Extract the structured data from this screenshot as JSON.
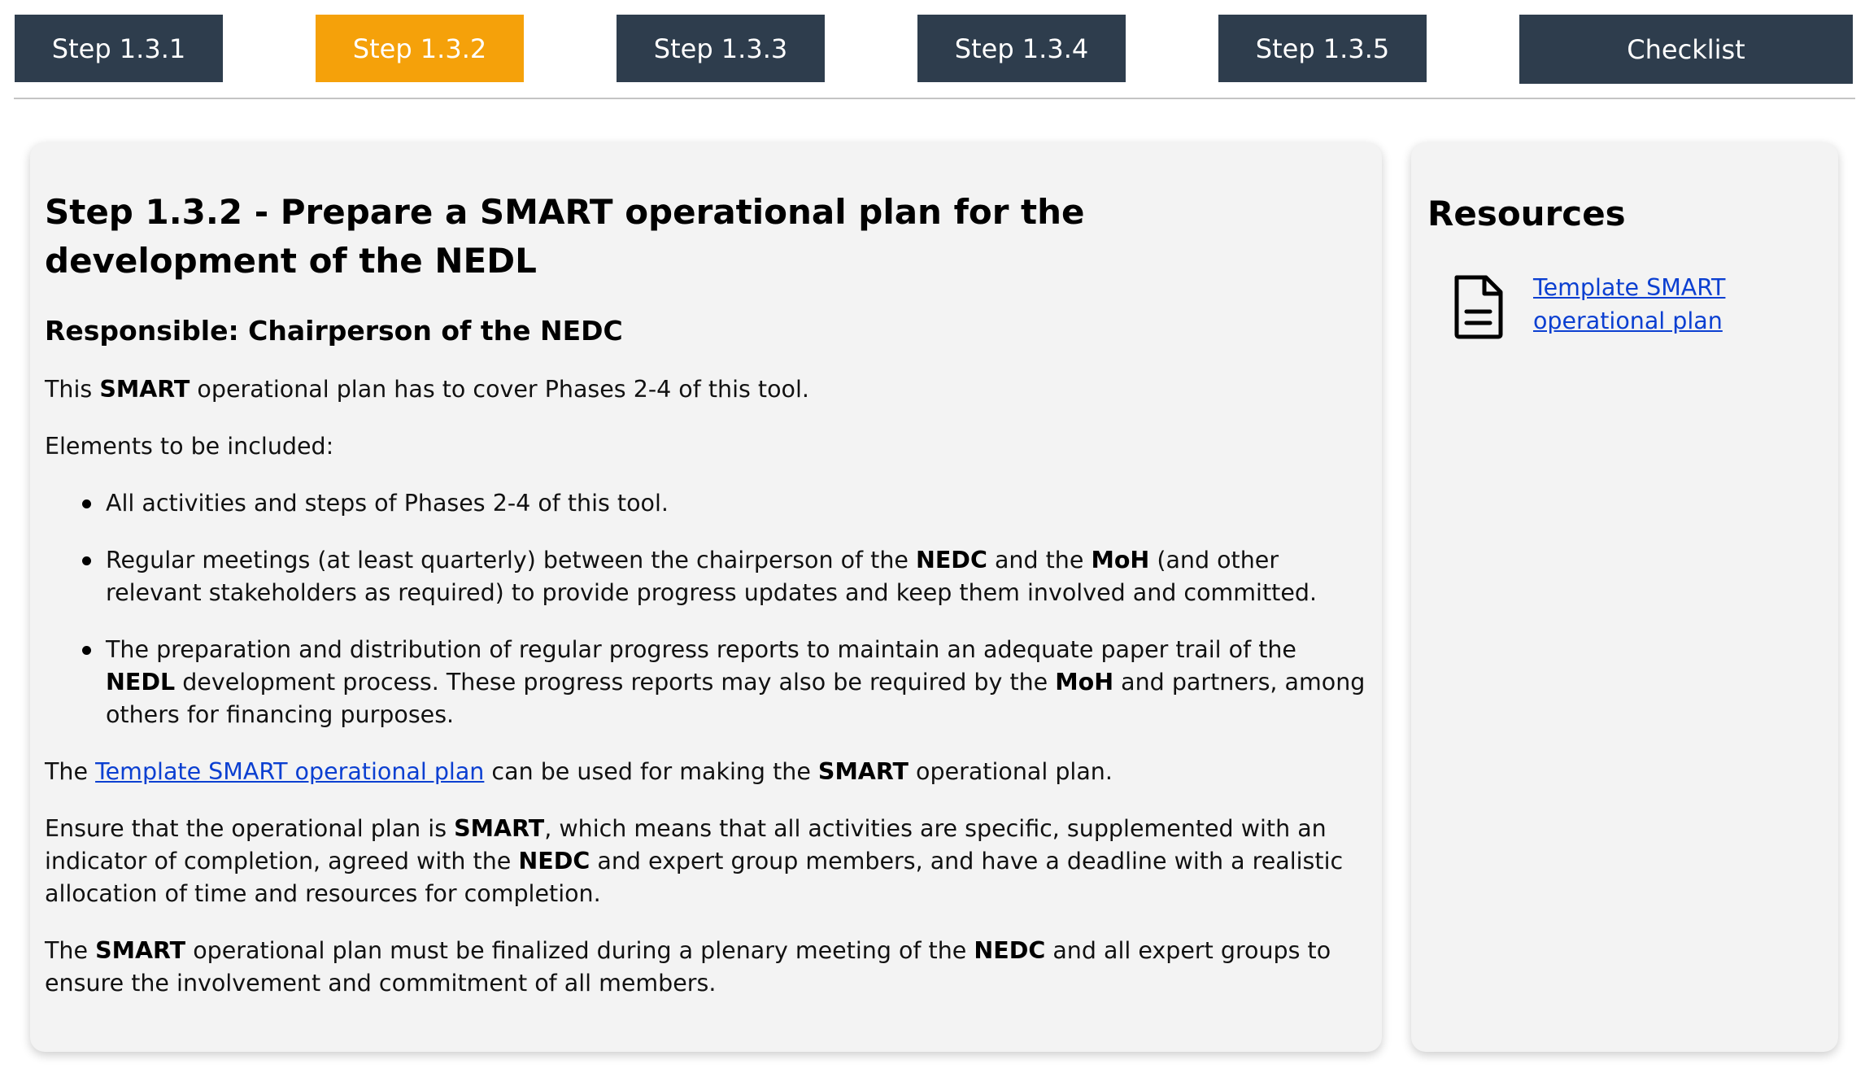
{
  "nav": {
    "steps": [
      {
        "label": "Step 1.3.1",
        "active": false
      },
      {
        "label": "Step 1.3.2",
        "active": true
      },
      {
        "label": "Step 1.3.3",
        "active": false
      },
      {
        "label": "Step 1.3.4",
        "active": false
      },
      {
        "label": "Step 1.3.5",
        "active": false
      }
    ],
    "checklist_label": "Checklist",
    "colors": {
      "default": "#2e3d4d",
      "active": "#f5a10a"
    }
  },
  "main": {
    "title": "Step 1.3.2 - Prepare a SMART operational plan for the development of the NEDL",
    "responsible": "Responsible: Chairperson of the NEDC",
    "intro": {
      "before": "This ",
      "bold": "SMART",
      "after": " operational plan has to cover Phases 2-4 of this tool."
    },
    "elements_heading": "Elements to be included:",
    "bullets": [
      {
        "t1": "All activities and steps of Phases 2-4 of this tool."
      },
      {
        "t1": "Regular meetings (at least quarterly) between the chairperson of the ",
        "b1": "NEDC",
        "t2": " and the ",
        "b2": "MoH",
        "t3": " (and other relevant stakeholders as required) to provide progress updates and keep them involved and committed."
      },
      {
        "t1": "The preparation and distribution of regular progress reports to maintain an adequate paper trail of the ",
        "b1": "NEDL",
        "t2": " development process. These progress reports may also be required by the ",
        "b2": "MoH",
        "t3": " and partners, among others for financing purposes."
      }
    ],
    "template_para": {
      "before": "The ",
      "link": "Template SMART operational plan",
      "middle": " can be used for making the ",
      "bold": "SMART",
      "after": " operational plan."
    },
    "ensure_para": {
      "before": "Ensure that the operational plan is ",
      "b1": "SMART",
      "middle": ", which means that all activities are specific, supplemented with an indicator of completion, agreed with the ",
      "b2": "NEDC",
      "after": " and expert group members, and have a deadline with a realistic allocation of time and resources for completion."
    },
    "final_para": {
      "before": "The ",
      "b1": "SMART",
      "middle": " operational plan must be finalized during a plenary meeting of the ",
      "b2": "NEDC",
      "after": " and all expert groups to ensure the involvement and commitment of all members."
    }
  },
  "resources": {
    "title": "Resources",
    "items": [
      {
        "icon": "document-icon",
        "label": "Template SMART operational plan"
      }
    ]
  },
  "colors": {
    "link": "#0b3fd1",
    "card_background": "#f3f3f3"
  }
}
